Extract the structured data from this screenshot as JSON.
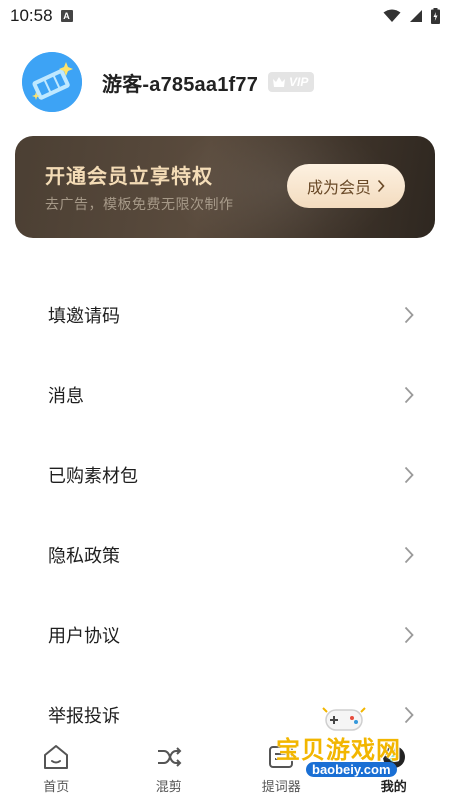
{
  "status_bar": {
    "time": "10:58",
    "notification_icon": "a-box-icon",
    "icons": [
      "wifi-icon",
      "signal-icon",
      "battery-icon"
    ]
  },
  "profile": {
    "username": "游客-a785aa1f77",
    "vip_badge": "VIP",
    "avatar_icon": "film-reel-avatar-icon"
  },
  "vip_card": {
    "title": "开通会员立享特权",
    "subtitle": "去广告，模板免费无限次制作",
    "button_label": "成为会员",
    "colors": {
      "card": "#4b3f33",
      "title": "#f4dcb6",
      "button": "#fbe9d3"
    }
  },
  "menu": {
    "items": [
      {
        "label": "填邀请码"
      },
      {
        "label": "消息"
      },
      {
        "label": "已购素材包"
      },
      {
        "label": "隐私政策"
      },
      {
        "label": "用户协议"
      },
      {
        "label": "举报投诉"
      }
    ]
  },
  "tabs": {
    "items": [
      {
        "label": "首页",
        "icon": "home-icon"
      },
      {
        "label": "混剪",
        "icon": "shuffle-icon"
      },
      {
        "label": "提词器",
        "icon": "teleprompter-icon"
      },
      {
        "label": "我的",
        "icon": "profile-icon",
        "active": true
      }
    ]
  },
  "watermark": {
    "text": "宝贝游戏网",
    "url": "baobeiy.com"
  }
}
